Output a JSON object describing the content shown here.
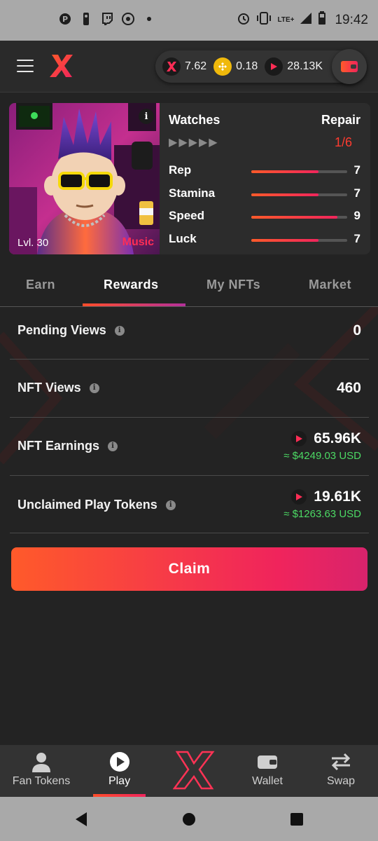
{
  "status_bar": {
    "time": "19:42",
    "network": "LTE+",
    "left_icons": [
      "pinterest-icon",
      "nba-icon",
      "twitch-icon",
      "chrome-icon",
      "dot-icon"
    ],
    "right_icons": [
      "alarm-icon",
      "vibrate-icon",
      "signal-icon",
      "battery-icon"
    ]
  },
  "header": {
    "balances": [
      {
        "token": "x-token",
        "value": "7.62"
      },
      {
        "token": "bnb-token",
        "value": "0.18"
      },
      {
        "token": "play-token",
        "value": "28.13K"
      }
    ],
    "wallet_icon": "wallet-icon"
  },
  "nft": {
    "level": "Lvl. 30",
    "genre": "Music",
    "name": "Watches",
    "repair_label": "Repair",
    "repair_count": "1/6",
    "rating_arrows": 5,
    "stats": [
      {
        "label": "Rep",
        "value": "7",
        "fill": 0.7
      },
      {
        "label": "Stamina",
        "value": "7",
        "fill": 0.7
      },
      {
        "label": "Speed",
        "value": "9",
        "fill": 0.9
      },
      {
        "label": "Luck",
        "value": "7",
        "fill": 0.7
      }
    ]
  },
  "tabs": [
    "Earn",
    "Rewards",
    "My NFTs",
    "Market"
  ],
  "active_tab": "Rewards",
  "rewards": {
    "pending_views": {
      "label": "Pending Views",
      "value": "0"
    },
    "nft_views": {
      "label": "NFT Views",
      "value": "460"
    },
    "nft_earnings": {
      "label": "NFT Earnings",
      "value": "65.96K",
      "usd": "≈ $4249.03 USD"
    },
    "unclaimed": {
      "label": "Unclaimed Play Tokens",
      "value": "19.61K",
      "usd": "≈ $1263.63 USD"
    },
    "claim_label": "Claim"
  },
  "bottom_nav": {
    "items": [
      {
        "label": "Fan Tokens",
        "icon": "person-icon"
      },
      {
        "label": "Play",
        "icon": "play-icon"
      },
      {
        "label": "",
        "icon": "x-logo-icon"
      },
      {
        "label": "Wallet",
        "icon": "wallet-icon"
      },
      {
        "label": "Swap",
        "icon": "swap-icon"
      }
    ],
    "active": "Play"
  },
  "colors": {
    "accent_orange": "#ff5a2a",
    "accent_pink": "#f0245c",
    "usd_green": "#4cd964",
    "background": "#232323"
  }
}
